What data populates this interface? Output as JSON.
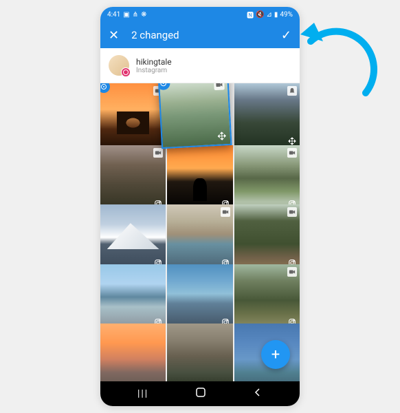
{
  "status": {
    "time": "4:41",
    "icons_left": [
      "camera",
      "share",
      "leaf"
    ],
    "icons_right": [
      "volume-off",
      "wifi-off",
      "signal"
    ],
    "battery_text": "49%"
  },
  "appbar": {
    "title": "2 changed"
  },
  "profile": {
    "name": "hikingtale",
    "platform": "Instagram"
  },
  "tiles": [
    {
      "scene": "s1",
      "top_icon": "video",
      "bottom_icon": null,
      "dragged": false,
      "has_target": true
    },
    {
      "scene": "s2",
      "top_icon": "video",
      "bottom_icon": "move",
      "dragged": true,
      "has_target": true
    },
    {
      "scene": "s3",
      "top_icon": "bell",
      "bottom_icon": "move",
      "dragged": false
    },
    {
      "scene": "s4",
      "top_icon": "video",
      "bottom_icon": "instagram",
      "dragged": false
    },
    {
      "scene": "s5",
      "top_icon": null,
      "bottom_icon": "instagram",
      "dragged": false
    },
    {
      "scene": "s6",
      "top_icon": "video",
      "bottom_icon": "instagram",
      "dragged": false
    },
    {
      "scene": "s7",
      "top_icon": null,
      "bottom_icon": "instagram",
      "dragged": false
    },
    {
      "scene": "s8",
      "top_icon": "video",
      "bottom_icon": "instagram",
      "dragged": false
    },
    {
      "scene": "s9",
      "top_icon": "video",
      "bottom_icon": "instagram",
      "dragged": false
    },
    {
      "scene": "s10",
      "top_icon": null,
      "bottom_icon": "instagram",
      "dragged": false
    },
    {
      "scene": "s11",
      "top_icon": null,
      "bottom_icon": "instagram",
      "dragged": false
    },
    {
      "scene": "s12",
      "top_icon": "video",
      "bottom_icon": "instagram",
      "dragged": false
    },
    {
      "scene": "s13",
      "top_icon": null,
      "bottom_icon": null,
      "dragged": false
    },
    {
      "scene": "s14",
      "top_icon": null,
      "bottom_icon": null,
      "dragged": false
    },
    {
      "scene": "s15",
      "top_icon": null,
      "bottom_icon": null,
      "dragged": false
    }
  ],
  "fab": {
    "label": "+"
  },
  "nav": {
    "recent": "|||",
    "home": "◯",
    "back": "〈"
  }
}
